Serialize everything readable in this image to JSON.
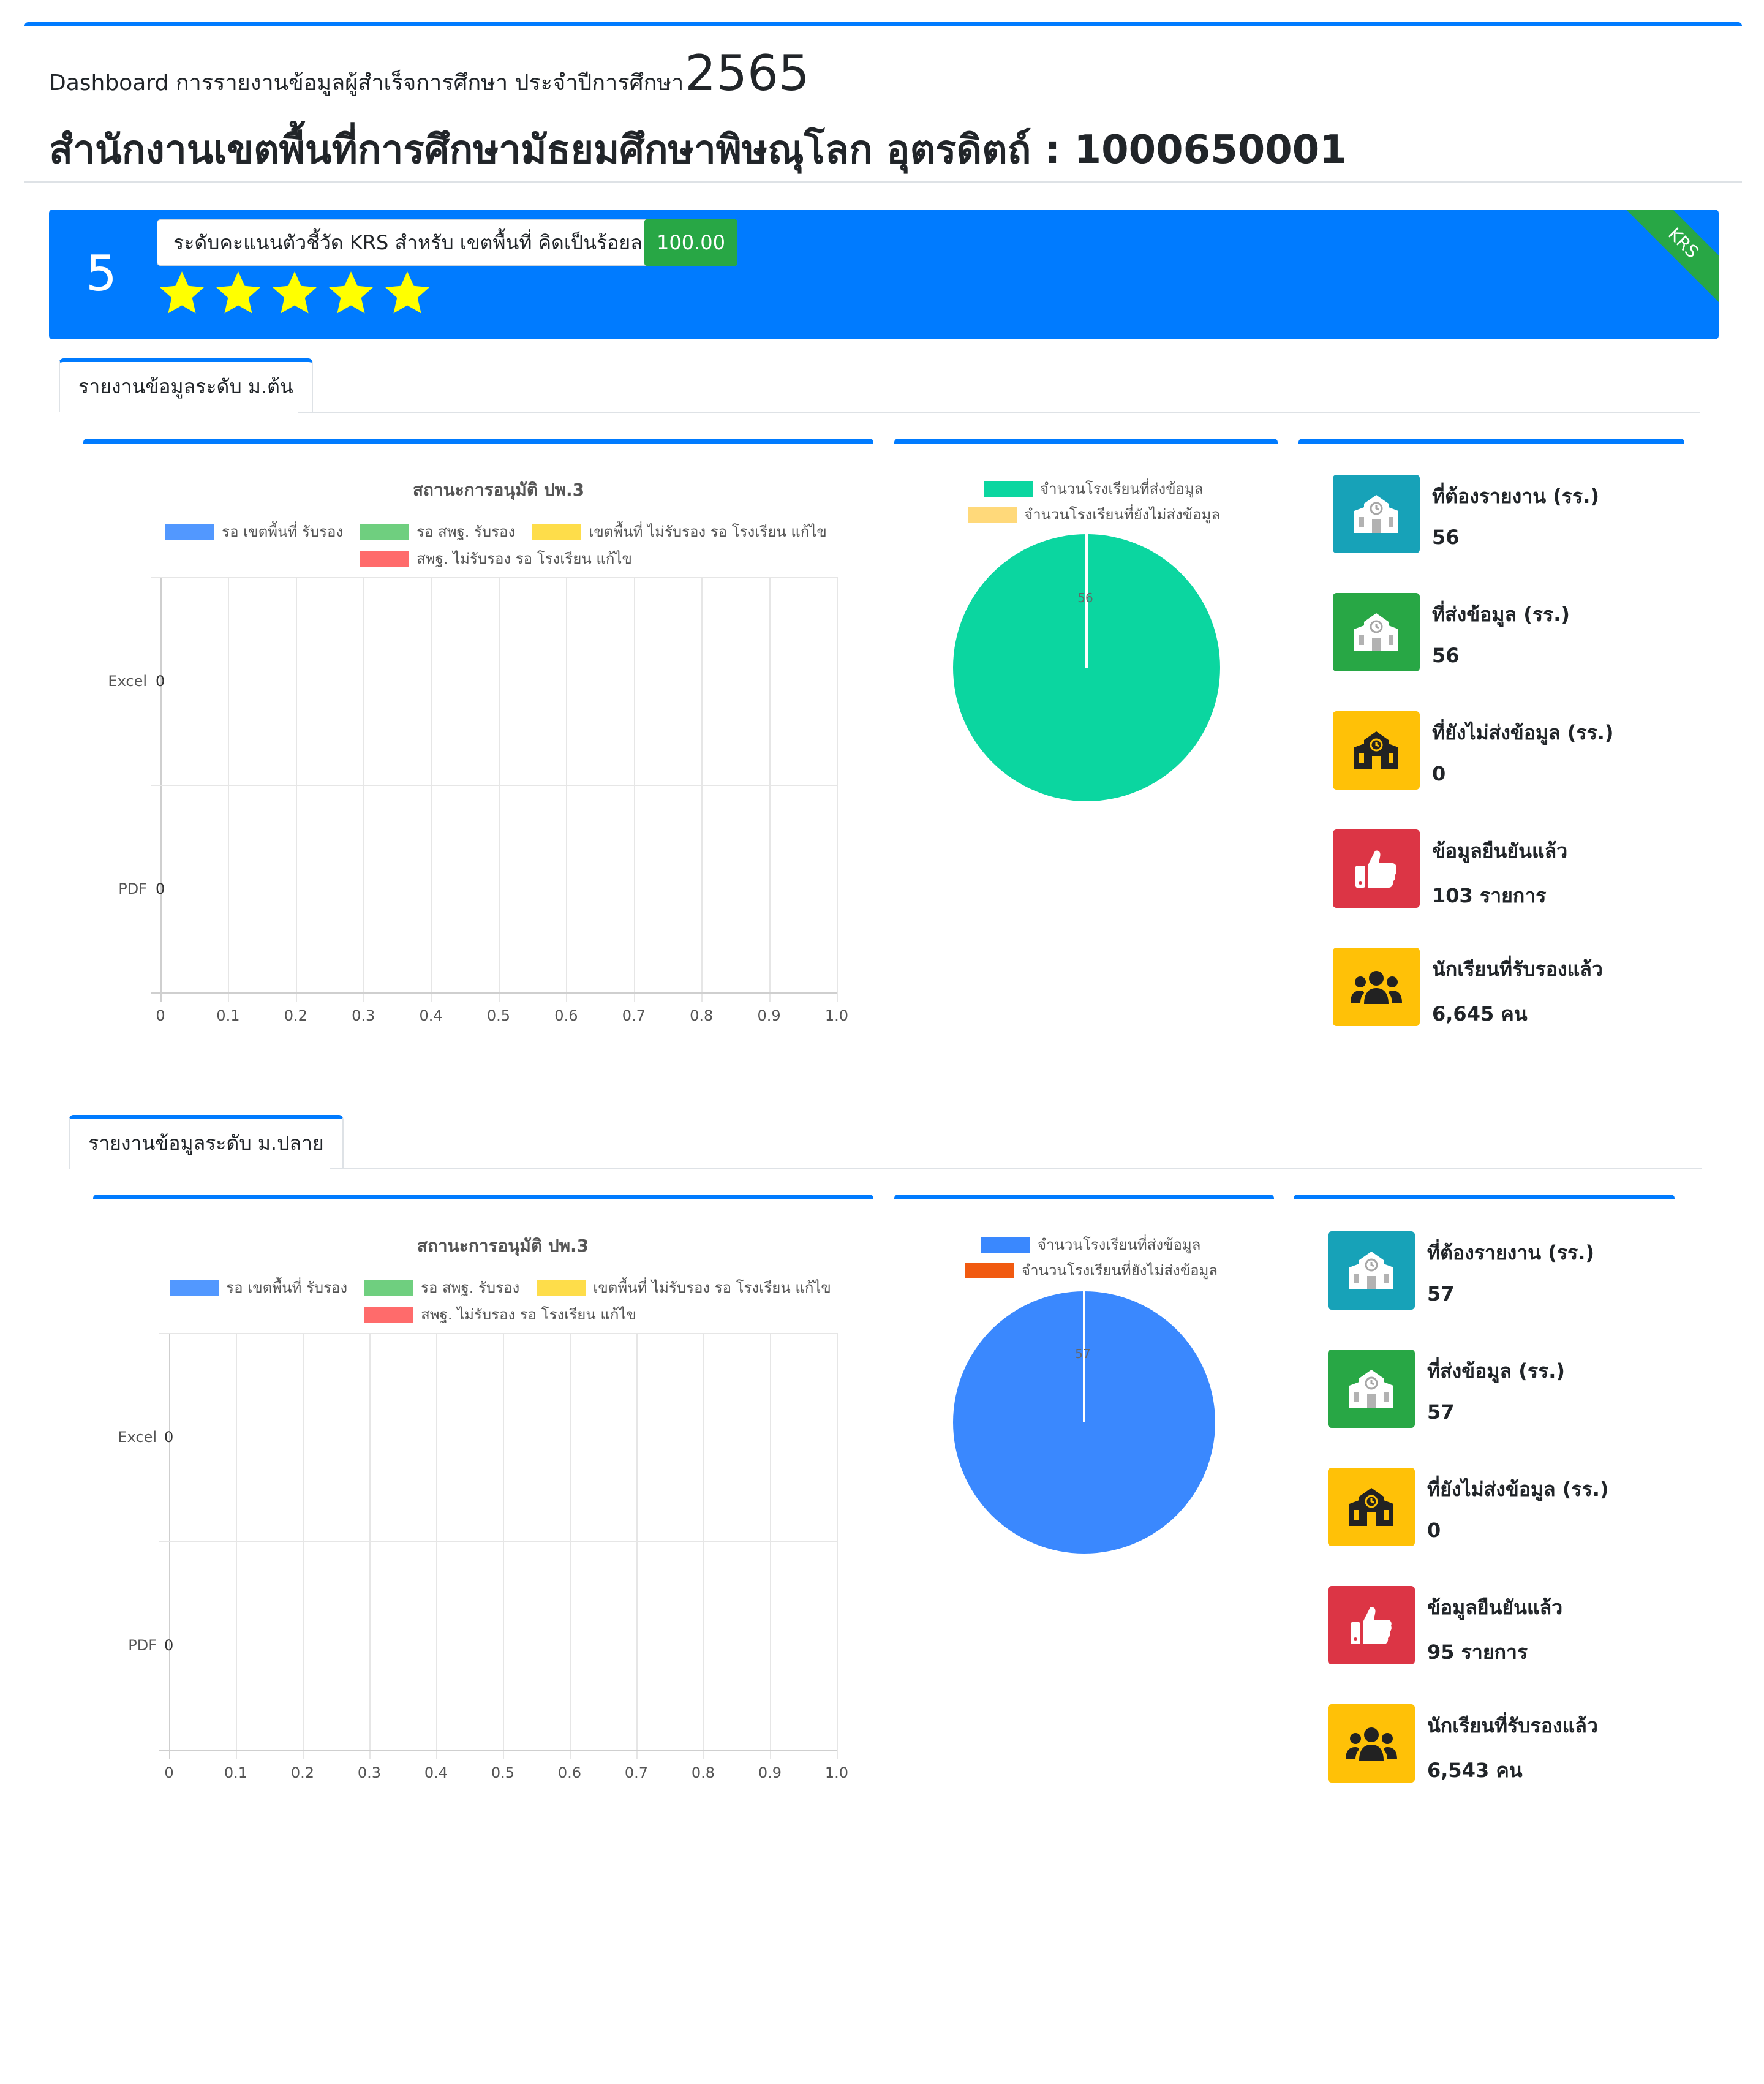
{
  "header": {
    "title_prefix": "Dashboard การรายงานข้อมูลผู้สำเร็จการศึกษา ประจำปีการศึกษา",
    "year": "2565",
    "office": "สำนักงานเขตพื้นที่การศึกษามัธยมศึกษาพิษณุโลก อุตรดิตถ์ : 1000650001"
  },
  "krs": {
    "score": "5",
    "label": "ระดับคะแนนตัวชี้วัด KRS สำหรับ เขตพื้นที่ คิดเป็นร้อยละ",
    "percent": "100.00",
    "stars": 5,
    "ribbon": "KRS"
  },
  "colors": {
    "primary": "#007bff",
    "success": "#28a745",
    "info": "#17a2b8",
    "warning": "#ffc107",
    "danger": "#dc3545",
    "star": "#ffff00"
  },
  "sections": [
    {
      "tab": "รายงานข้อมูลระดับ ม.ต้น",
      "bar_chart": {
        "title": "สถานะการอนุมัติ ปพ.3",
        "legend": [
          "รอ เขตพื้นที่ รับรอง",
          "รอ สพฐ. รับรอง",
          "เขตพื้นที่ ไม่รับรอง รอ โรงเรียน แก้ไข",
          "สพฐ. ไม่รับรอง รอ โรงเรียน แก้ไข"
        ],
        "legend_colors": [
          "#5298ff",
          "#6fcf7f",
          "#fedd4a",
          "#ff6b6b"
        ]
      },
      "pie_chart": {
        "legend": [
          "จำนวนโรงเรียนที่ส่งข้อมูล",
          "จำนวนโรงเรียนที่ยังไม่ส่งข้อมูล"
        ],
        "legend_colors": [
          "#0bd6a0",
          "#ffd97a"
        ],
        "slice_label": "56"
      },
      "stats": [
        {
          "label": "ที่ต้องรายงาน (รร.)",
          "value": "56"
        },
        {
          "label": "ที่ส่งข้อมูล (รร.)",
          "value": "56"
        },
        {
          "label": "ที่ยังไม่ส่งข้อมูล (รร.)",
          "value": "0"
        },
        {
          "label": "ข้อมูลยืนยันแล้ว",
          "value": "103 รายการ"
        },
        {
          "label": "นักเรียนที่รับรองแล้ว",
          "value": "6,645 คน"
        }
      ]
    },
    {
      "tab": "รายงานข้อมูลระดับ ม.ปลาย",
      "bar_chart": {
        "title": "สถานะการอนุมัติ ปพ.3",
        "legend": [
          "รอ เขตพื้นที่ รับรอง",
          "รอ สพฐ. รับรอง",
          "เขตพื้นที่ ไม่รับรอง รอ โรงเรียน แก้ไข",
          "สพฐ. ไม่รับรอง รอ โรงเรียน แก้ไข"
        ],
        "legend_colors": [
          "#5298ff",
          "#6fcf7f",
          "#fedd4a",
          "#ff6b6b"
        ]
      },
      "pie_chart": {
        "legend": [
          "จำนวนโรงเรียนที่ส่งข้อมูล",
          "จำนวนโรงเรียนที่ยังไม่ส่งข้อมูล"
        ],
        "legend_colors": [
          "#3a88fe",
          "#f15a10"
        ],
        "slice_label": "57"
      },
      "stats": [
        {
          "label": "ที่ต้องรายงาน (รร.)",
          "value": "57"
        },
        {
          "label": "ที่ส่งข้อมูล (รร.)",
          "value": "57"
        },
        {
          "label": "ที่ยังไม่ส่งข้อมูล (รร.)",
          "value": "0"
        },
        {
          "label": "ข้อมูลยืนยันแล้ว",
          "value": "95 รายการ"
        },
        {
          "label": "นักเรียนที่รับรองแล้ว",
          "value": "6,543 คน"
        }
      ]
    }
  ],
  "chart_data": [
    {
      "type": "bar",
      "orientation": "horizontal",
      "title": "สถานะการอนุมัติ ปพ.3",
      "categories": [
        "Excel",
        "PDF"
      ],
      "series": [
        {
          "name": "รอ เขตพื้นที่ รับรอง",
          "values": [
            0,
            0
          ]
        },
        {
          "name": "รอ สพฐ. รับรอง",
          "values": [
            0,
            0
          ]
        },
        {
          "name": "เขตพื้นที่ ไม่รับรอง รอ โรงเรียน แก้ไข",
          "values": [
            0,
            0
          ]
        },
        {
          "name": "สพฐ. ไม่รับรอง รอ โรงเรียน แก้ไข",
          "values": [
            0,
            0
          ]
        }
      ],
      "data_labels": [
        "0",
        "0"
      ],
      "xlim": [
        0,
        1.0
      ],
      "xticks": [
        "0",
        "0.1",
        "0.2",
        "0.3",
        "0.4",
        "0.5",
        "0.6",
        "0.7",
        "0.8",
        "0.9",
        "1.0"
      ],
      "grid": true,
      "legend_position": "top"
    },
    {
      "type": "pie",
      "labels": [
        "จำนวนโรงเรียนที่ส่งข้อมูล",
        "จำนวนโรงเรียนที่ยังไม่ส่งข้อมูล"
      ],
      "values": [
        56,
        0
      ],
      "legend_position": "top"
    },
    {
      "type": "bar",
      "orientation": "horizontal",
      "title": "สถานะการอนุมัติ ปพ.3",
      "categories": [
        "Excel",
        "PDF"
      ],
      "series": [
        {
          "name": "รอ เขตพื้นที่ รับรอง",
          "values": [
            0,
            0
          ]
        },
        {
          "name": "รอ สพฐ. รับรอง",
          "values": [
            0,
            0
          ]
        },
        {
          "name": "เขตพื้นที่ ไม่รับรอง รอ โรงเรียน แก้ไข",
          "values": [
            0,
            0
          ]
        },
        {
          "name": "สพฐ. ไม่รับรอง รอ โรงเรียน แก้ไข",
          "values": [
            0,
            0
          ]
        }
      ],
      "data_labels": [
        "0",
        "0"
      ],
      "xlim": [
        0,
        1.0
      ],
      "xticks": [
        "0",
        "0.1",
        "0.2",
        "0.3",
        "0.4",
        "0.5",
        "0.6",
        "0.7",
        "0.8",
        "0.9",
        "1.0"
      ],
      "grid": true,
      "legend_position": "top"
    },
    {
      "type": "pie",
      "labels": [
        "จำนวนโรงเรียนที่ส่งข้อมูล",
        "จำนวนโรงเรียนที่ยังไม่ส่งข้อมูล"
      ],
      "values": [
        57,
        0
      ],
      "legend_position": "top"
    }
  ]
}
